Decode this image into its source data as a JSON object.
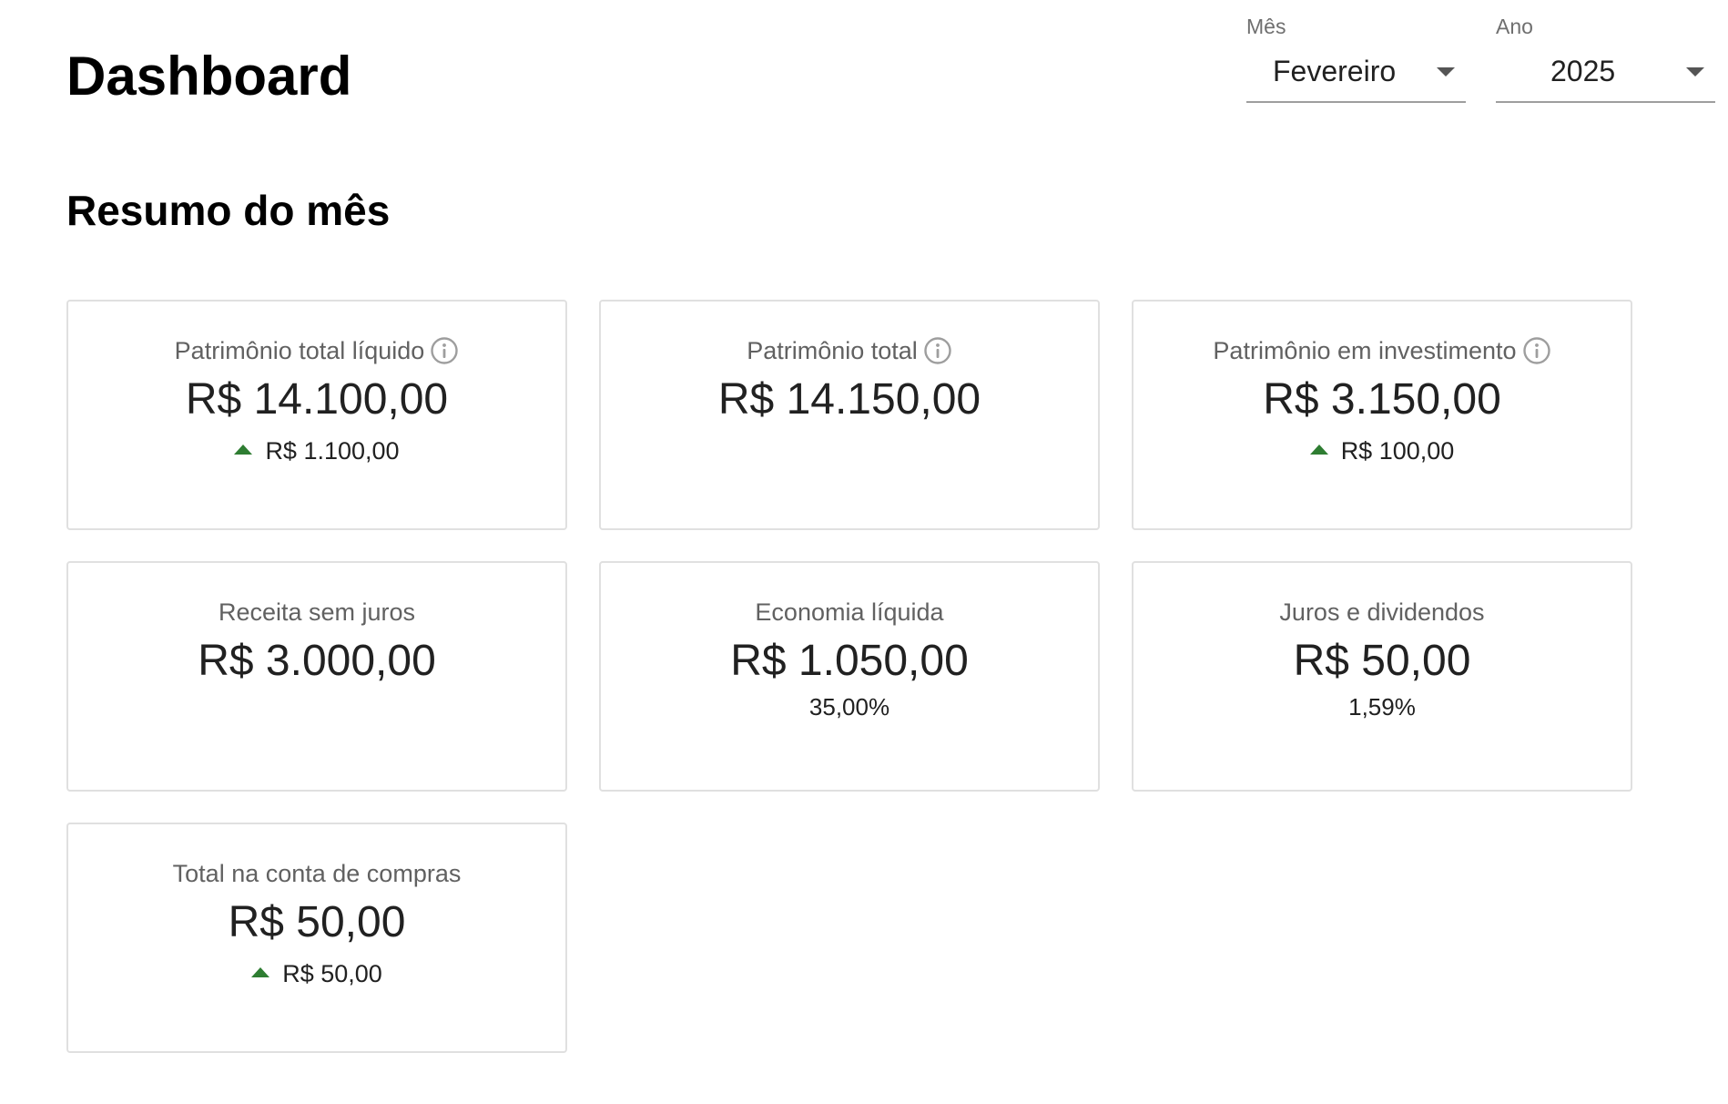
{
  "header": {
    "title": "Dashboard",
    "month_select": {
      "label": "Mês",
      "value": "Fevereiro"
    },
    "year_select": {
      "label": "Ano",
      "value": "2025"
    }
  },
  "summary": {
    "title": "Resumo do mês",
    "cards": [
      {
        "label": "Patrimônio total líquido",
        "value": "R$ 14.100,00",
        "delta": "R$ 1.100,00",
        "delta_direction": "up",
        "has_info": true
      },
      {
        "label": "Patrimônio total",
        "value": "R$ 14.150,00",
        "has_info": true
      },
      {
        "label": "Patrimônio em investimento",
        "value": "R$ 3.150,00",
        "delta": "R$ 100,00",
        "delta_direction": "up",
        "has_info": true
      },
      {
        "label": "Receita sem juros",
        "value": "R$ 3.000,00"
      },
      {
        "label": "Economia líquida",
        "value": "R$ 1.050,00",
        "sub": "35,00%"
      },
      {
        "label": "Juros e dividendos",
        "value": "R$ 50,00",
        "sub": "1,59%"
      },
      {
        "label": "Total na conta de compras",
        "value": "R$ 50,00",
        "delta": "R$ 50,00",
        "delta_direction": "up"
      }
    ]
  },
  "colors": {
    "positive": "#2e7d32",
    "card_border": "#e0e0e0",
    "label_text": "#616161"
  },
  "icons": {
    "info": "info-circle-icon",
    "delta_up": "triangle-up-icon",
    "dropdown": "caret-down-icon"
  }
}
